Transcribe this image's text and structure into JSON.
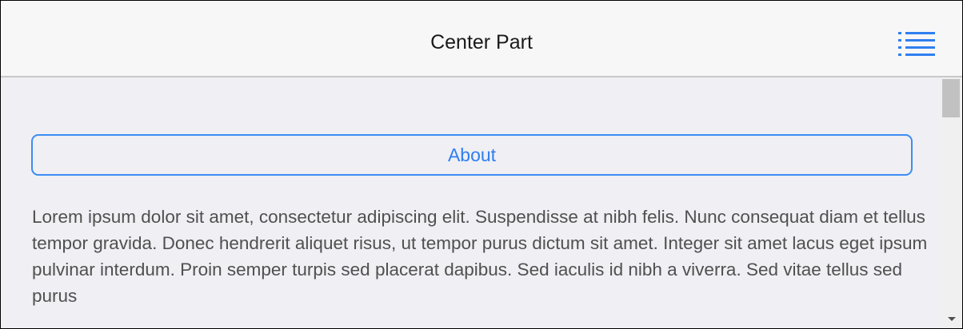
{
  "header": {
    "title": "Center Part",
    "menu_icon": "list-icon"
  },
  "content": {
    "button_label": "About",
    "paragraph": "Lorem ipsum dolor sit amet, consectetur adipiscing elit. Suspendisse at nibh felis. Nunc consequat diam et tellus tempor gravida. Donec hendrerit aliquet risus, ut tempor purus dictum sit amet. Integer sit amet lacus eget ipsum pulvinar interdum. Proin semper turpis sed placerat dapibus. Sed iaculis id nibh a viverra. Sed vitae tellus sed purus"
  },
  "colors": {
    "accent": "#3c8cf4",
    "header_bg": "#f7f7f8",
    "content_bg": "#efeff4",
    "text": "#505050"
  }
}
